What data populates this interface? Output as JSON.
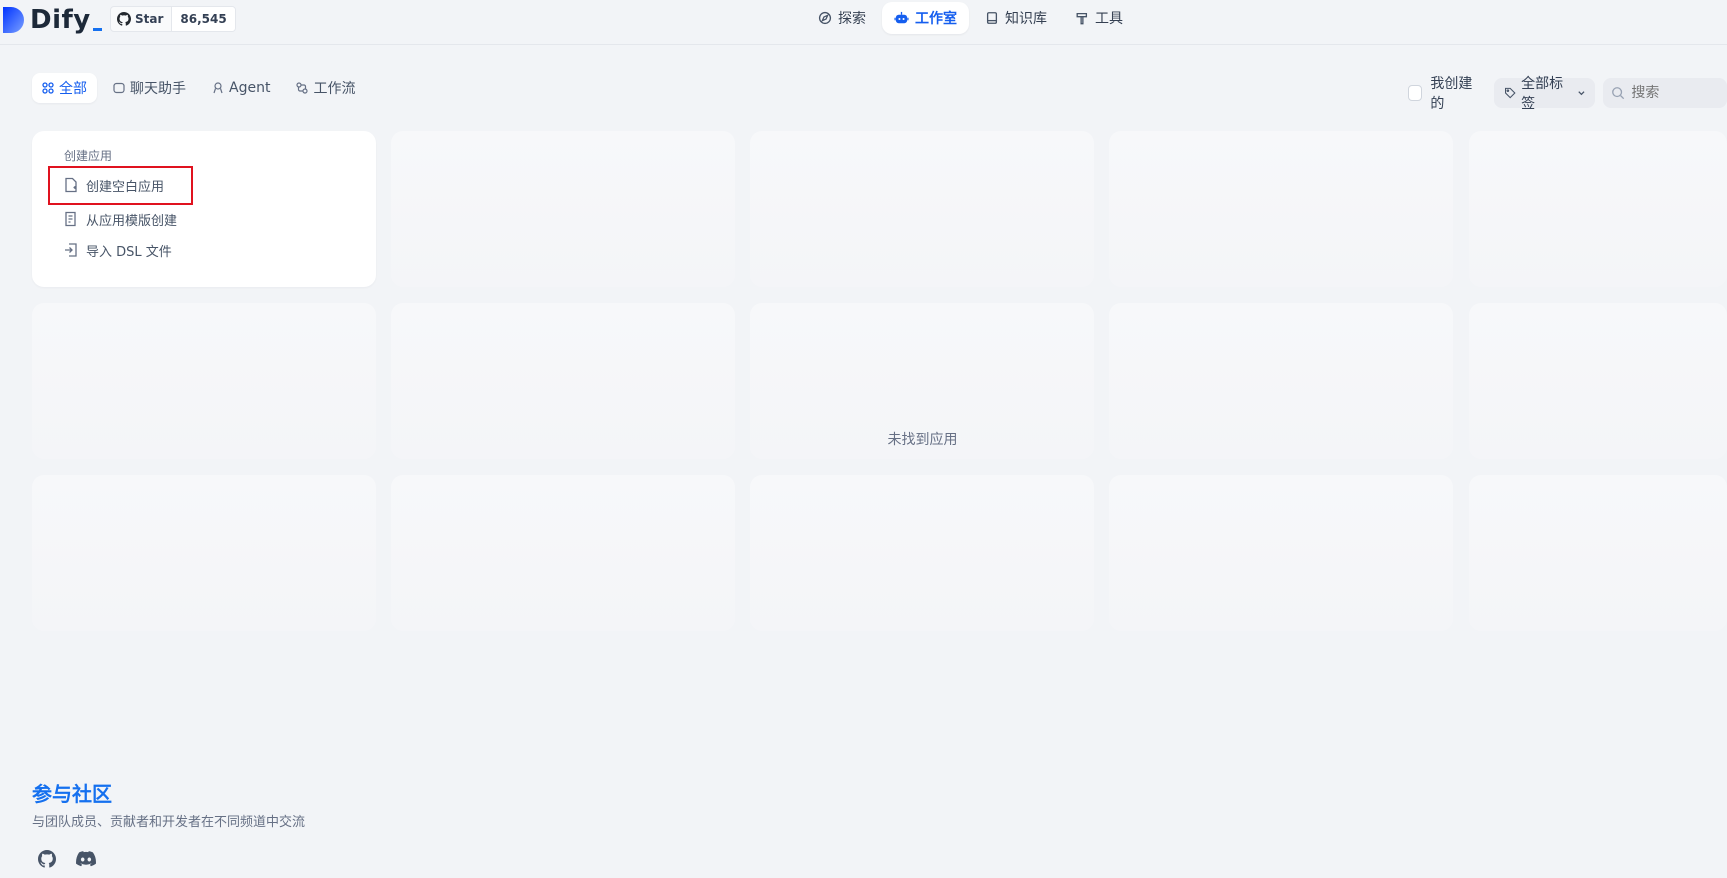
{
  "header": {
    "logo_text": "Dify",
    "github": {
      "label": "Star",
      "count": "86,545"
    },
    "nav": [
      {
        "label": "探索",
        "icon": "compass-icon"
      },
      {
        "label": "工作室",
        "icon": "robot-icon",
        "active": true
      },
      {
        "label": "知识库",
        "icon": "book-icon"
      },
      {
        "label": "工具",
        "icon": "hammer-icon"
      }
    ]
  },
  "filters": {
    "tabs": [
      {
        "label": "全部",
        "icon": "grid-icon",
        "active": true
      },
      {
        "label": "聊天助手",
        "icon": "chat-icon"
      },
      {
        "label": "Agent",
        "icon": "agent-icon"
      },
      {
        "label": "工作流",
        "icon": "workflow-icon"
      }
    ],
    "my_created_label": "我创建的",
    "tags_label": "全部标签",
    "search_placeholder": "搜索"
  },
  "create_card": {
    "title": "创建应用",
    "items": [
      {
        "label": "创建空白应用",
        "icon": "file-plus-icon"
      },
      {
        "label": "从应用模版创建",
        "icon": "template-icon"
      },
      {
        "label": "导入 DSL 文件",
        "icon": "import-icon"
      }
    ]
  },
  "empty_state": "未找到应用",
  "community": {
    "title": "参与社区",
    "description": "与团队成员、贡献者和开发者在不同频道中交流",
    "icons": [
      "github-icon",
      "discord-icon"
    ]
  },
  "colors": {
    "accent": "#155eef",
    "background": "#f2f4f7",
    "highlight_box": "#e0121f"
  }
}
